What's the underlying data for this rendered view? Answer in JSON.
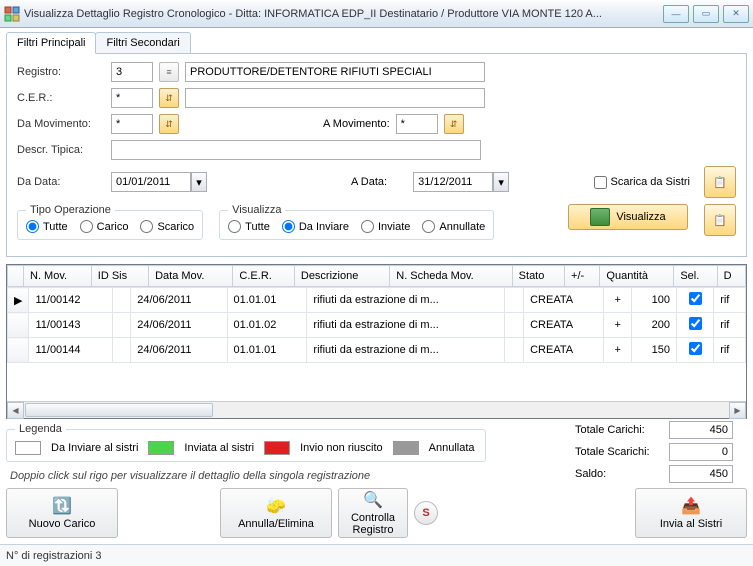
{
  "window": {
    "title": "Visualizza Dettaglio Registro Cronologico - Ditta: INFORMATICA EDP_II Destinatario / Produttore VIA MONTE 120 A..."
  },
  "tabs": {
    "primary": "Filtri Principali",
    "secondary": "Filtri Secondari"
  },
  "filters": {
    "registro_lbl": "Registro:",
    "registro_val": "3",
    "registro_desc": "PRODUTTORE/DETENTORE RIFIUTI SPECIALI",
    "cer_lbl": "C.E.R.:",
    "cer_val": "*",
    "da_mov_lbl": "Da Movimento:",
    "da_mov_val": "*",
    "a_mov_lbl": "A Movimento:",
    "a_mov_val": "*",
    "descr_lbl": "Descr. Tipica:",
    "descr_val": "",
    "da_data_lbl": "Da Data:",
    "da_data_val": "01/01/2011",
    "a_data_lbl": "A Data:",
    "a_data_val": "31/12/2011",
    "scarica_lbl": "Scarica da Sistri",
    "visualizza_btn": "Visualizza"
  },
  "tipo_op": {
    "legend": "Tipo Operazione",
    "tutte": "Tutte",
    "carico": "Carico",
    "scarico": "Scarico"
  },
  "viz": {
    "legend": "Visualizza",
    "tutte": "Tutte",
    "da_inviare": "Da Inviare",
    "inviate": "Inviate",
    "annullate": "Annullate"
  },
  "grid": {
    "cols": [
      "",
      "N. Mov.",
      "ID Sis",
      "Data Mov.",
      "C.E.R.",
      "Descrizione",
      "N. Scheda Mov.",
      "Stato",
      "+/-",
      "Quantità",
      "Sel.",
      "D"
    ],
    "rows": [
      {
        "sel": "▶",
        "n": "11/00142",
        "id": "",
        "data": "24/06/2011",
        "cer": "01.01.01",
        "desc": "rifiuti da estrazione di m...",
        "scheda": "",
        "stato": "CREATA",
        "pm": "+",
        "q": "100",
        "chk": true,
        "d": "rif"
      },
      {
        "sel": "",
        "n": "11/00143",
        "id": "",
        "data": "24/06/2011",
        "cer": "01.01.02",
        "desc": "rifiuti da estrazione di m...",
        "scheda": "",
        "stato": "CREATA",
        "pm": "+",
        "q": "200",
        "chk": true,
        "d": "rif"
      },
      {
        "sel": "",
        "n": "11/00144",
        "id": "",
        "data": "24/06/2011",
        "cer": "01.01.01",
        "desc": "rifiuti da estrazione di m...",
        "scheda": "",
        "stato": "CREATA",
        "pm": "+",
        "q": "150",
        "chk": true,
        "d": "rif"
      }
    ]
  },
  "legend": {
    "title": "Legenda",
    "da_inviare": "Da Inviare al sistri",
    "inviata": "Inviata al sistri",
    "fallito": "Invio non riuscito",
    "annullata": "Annullata"
  },
  "totals": {
    "carichi_lbl": "Totale Carichi:",
    "carichi_val": "450",
    "scarichi_lbl": "Totale Scarichi:",
    "scarichi_val": "0",
    "saldo_lbl": "Saldo:",
    "saldo_val": "450"
  },
  "hint": "Doppio click sul rigo per visualizzare il dettaglio della singola registrazione",
  "buttons": {
    "nuovo": "Nuovo Carico",
    "annulla": "Annulla/Elimina",
    "controlla": "Controlla Registro",
    "s": "S",
    "invia": "Invia al Sistri"
  },
  "status": "N° di registrazioni 3"
}
